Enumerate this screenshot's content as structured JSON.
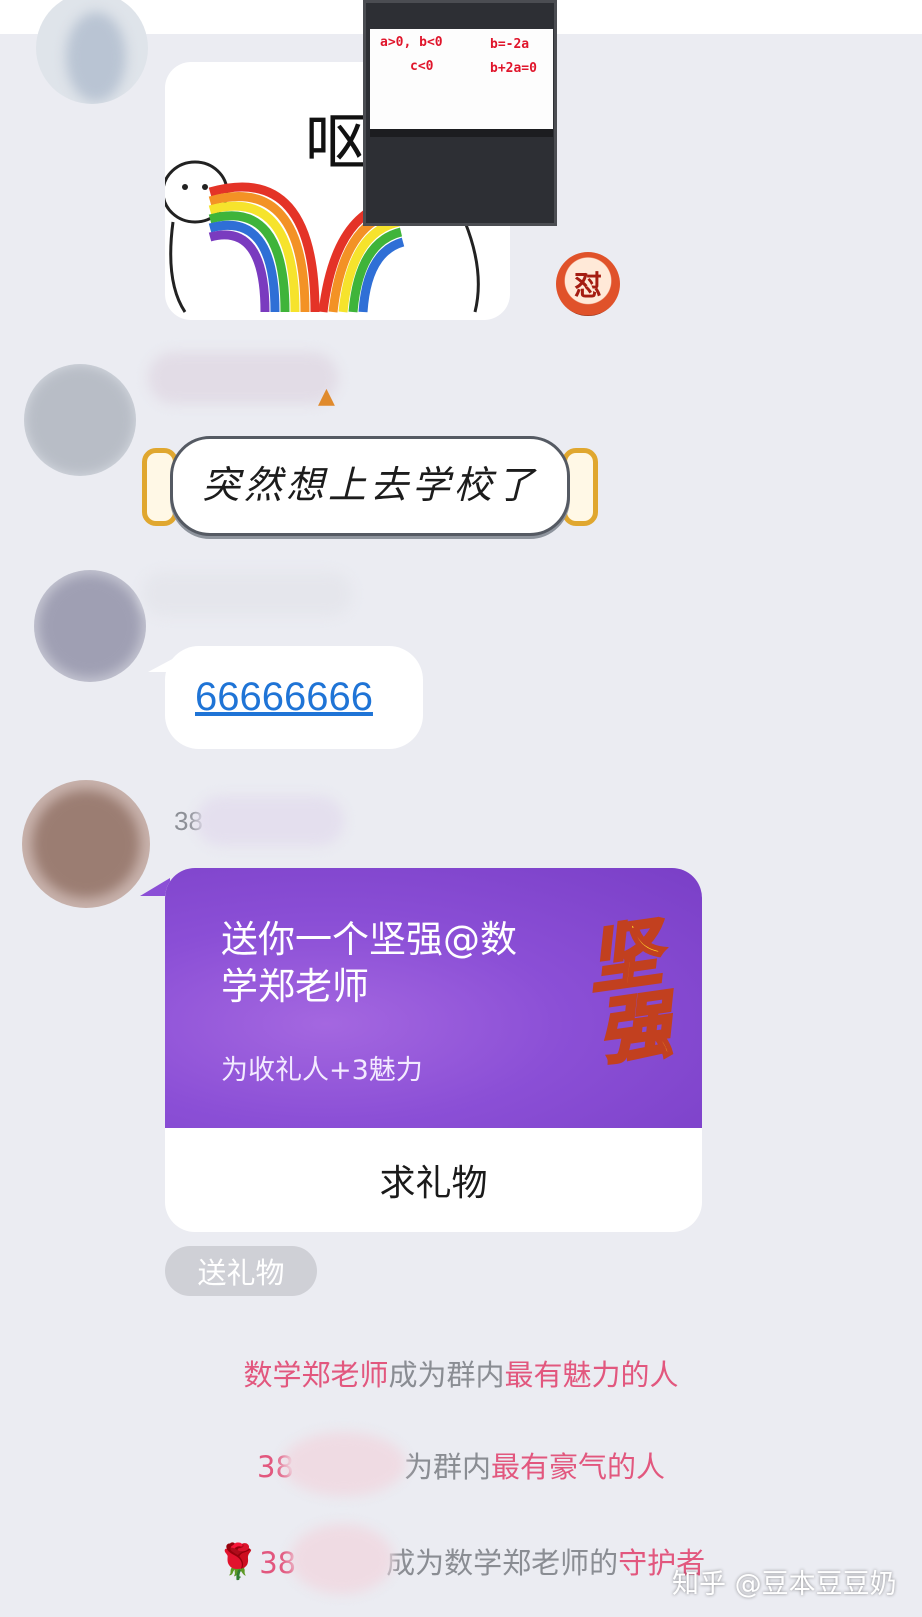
{
  "sticker_top": {
    "caption": "呕"
  },
  "pip_overlay": {
    "lines": [
      "a>0, b<0",
      "b=-2a",
      "c<0",
      "b+2a=0"
    ]
  },
  "reaction_badge": {
    "glyph": "怼"
  },
  "sticker_scroll": {
    "text": "突然想上去学校了"
  },
  "message_link": {
    "text": "66666666"
  },
  "gift_message": {
    "sender_prefix": "38",
    "title": "送你一个坚强@数学郑老师",
    "subtitle": "为收礼人+3魅力",
    "sticker_text": "坚强",
    "action_button": "求礼物"
  },
  "send_gift_button": "送礼物",
  "system_notices": [
    {
      "name": "数学郑老师",
      "middle": "成为群内",
      "title": "最有魅力的人"
    },
    {
      "name": "38",
      "middle": "为群内",
      "title": "最有豪气的人"
    },
    {
      "icon": "🌹",
      "name": "38",
      "middle": "成为数学郑老师的",
      "title": "守护者"
    }
  ],
  "watermark": "知乎 @豆本豆豆奶"
}
